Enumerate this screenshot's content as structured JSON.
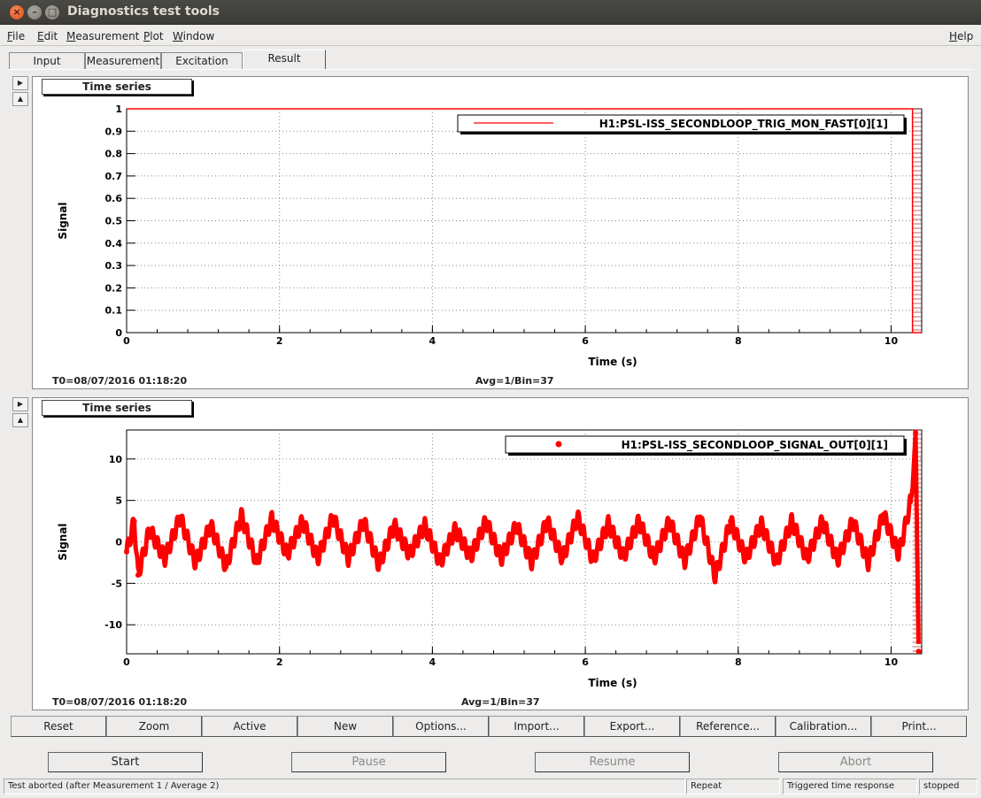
{
  "window": {
    "title": "Diagnostics test tools"
  },
  "menu": {
    "file": {
      "u": "F",
      "rest": "ile"
    },
    "edit": {
      "u": "E",
      "rest": "dit"
    },
    "measurement": {
      "u": "M",
      "rest": "easurement"
    },
    "plot": {
      "u": "P",
      "rest": "lot"
    },
    "window": {
      "u": "W",
      "rest": "indow"
    },
    "help": {
      "u": "H",
      "rest": "elp"
    }
  },
  "tabs": [
    "Input",
    "Measurement",
    "Excitation",
    "Result"
  ],
  "active_tab": "Result",
  "plots": [
    {
      "panel_title": "Time series",
      "footer_left": "T0=08/07/2016 01:18:20",
      "footer_center": "Avg=1/Bin=37",
      "legend": "H1:PSL-ISS_SECONDLOOP_TRIG_MON_FAST[0][1]"
    },
    {
      "panel_title": "Time series",
      "footer_left": "T0=08/07/2016 01:18:20",
      "footer_center": "Avg=1/Bin=37",
      "legend": "H1:PSL-ISS_SECONDLOOP_SIGNAL_OUT[0][1]"
    }
  ],
  "chart_data": [
    {
      "type": "line",
      "xlabel": "Time (s)",
      "ylabel": "Signal",
      "xlim": [
        0,
        10.4
      ],
      "ylim": [
        0,
        1
      ],
      "x_ticks": [
        "0",
        "2",
        "4",
        "6",
        "8",
        "10"
      ],
      "y_ticks": [
        "0",
        "0.1",
        "0.2",
        "0.3",
        "0.4",
        "0.5",
        "0.6",
        "0.7",
        "0.8",
        "0.9",
        "1"
      ],
      "grid": true,
      "legend_position": "top-right",
      "series": [
        {
          "name": "H1:PSL-ISS_SECONDLOOP_TRIG_MON_FAST[0][1]",
          "color": "#ff0000",
          "x": [
            0,
            10.28,
            10.28,
            10.4
          ],
          "y": [
            1,
            1,
            0,
            0
          ]
        }
      ]
    },
    {
      "type": "scatter",
      "xlabel": "Time (s)",
      "ylabel": "Signal",
      "xlim": [
        0,
        10.4
      ],
      "ylim": [
        -13.5,
        13.5
      ],
      "x_ticks": [
        "0",
        "2",
        "4",
        "6",
        "8",
        "10"
      ],
      "y_ticks": [
        "-10",
        "-5",
        "0",
        "5",
        "10"
      ],
      "grid": true,
      "legend_position": "top-right",
      "series": [
        {
          "name": "H1:PSL-ISS_SECONDLOOP_SIGNAL_OUT[0][1]",
          "color": "#ff0000",
          "x": [
            0,
            0.1,
            0.15,
            0.3,
            0.5,
            0.7,
            0.9,
            1.1,
            1.3,
            1.5,
            1.7,
            1.9,
            2.1,
            2.3,
            2.5,
            2.7,
            2.9,
            3.1,
            3.3,
            3.5,
            3.7,
            3.9,
            4.1,
            4.3,
            4.5,
            4.7,
            4.9,
            5.1,
            5.3,
            5.5,
            5.7,
            5.9,
            6.1,
            6.3,
            6.5,
            6.7,
            6.9,
            7.1,
            7.3,
            7.5,
            7.7,
            7.9,
            8.1,
            8.3,
            8.5,
            8.7,
            8.9,
            9.1,
            9.3,
            9.5,
            9.7,
            9.9,
            10.1,
            10.2,
            10.25,
            10.28,
            10.32,
            10.36
          ],
          "y": [
            -1.2,
            2.5,
            -4,
            1.5,
            -2,
            3,
            -2.5,
            2,
            -3,
            3.2,
            -2.5,
            2.8,
            -1.5,
            2.5,
            -2,
            3,
            -2,
            2.5,
            -2.8,
            2,
            -1.5,
            2,
            -2.5,
            1.5,
            -1.8,
            2.5,
            -2,
            2,
            -2.5,
            2.5,
            -2,
            3,
            -2.2,
            2.2,
            -1.8,
            2.5,
            -2,
            2.5,
            -2.3,
            3,
            -4.2,
            2.5,
            -2,
            2.2,
            -2.5,
            2.5,
            -2,
            2.5,
            -2.2,
            2.5,
            -2.5,
            3.3,
            -1.5,
            2.5,
            4.8,
            6.2,
            13.2,
            -13.2
          ]
        }
      ]
    }
  ],
  "buttons": {
    "plot_actions": [
      "Reset",
      "Zoom",
      "Active",
      "New",
      "Options...",
      "Import...",
      "Export...",
      "Reference...",
      "Calibration...",
      "Print..."
    ],
    "controls": [
      "Start",
      "Pause",
      "Resume",
      "Abort"
    ]
  },
  "status": {
    "message": "Test aborted (after Measurement 1 / Average 2)",
    "mode": "Repeat",
    "test_type": "Triggered time response",
    "state": "stopped"
  }
}
